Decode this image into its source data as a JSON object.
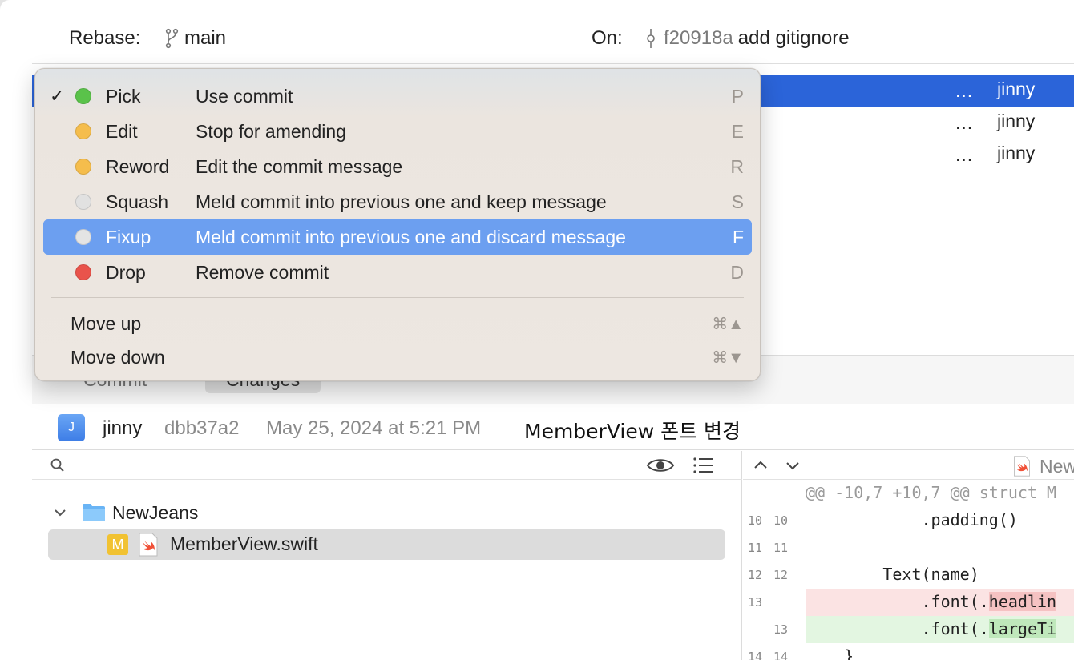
{
  "header": {
    "rebase_label": "Rebase:",
    "branch_icon": "branch-icon",
    "branch": "main",
    "on_label": "On:",
    "commit_icon": "commit-icon",
    "on_sha": "f20918a",
    "on_message": "add gitignore"
  },
  "commits": [
    {
      "dots": "...",
      "author": "jinny",
      "selected": true
    },
    {
      "dots": "...",
      "author": "jinny",
      "selected": false
    },
    {
      "dots": "...",
      "author": "jinny",
      "selected": false
    }
  ],
  "tabs": [
    {
      "label": "Commit",
      "active": false
    },
    {
      "label": "Changes",
      "active": true
    }
  ],
  "commit_info": {
    "avatar_letter": "J",
    "author": "jinny",
    "sha": "dbb37a2",
    "date": "May 25, 2024 at 5:21 PM",
    "message": "MemberView 폰트 변경"
  },
  "file_tree": {
    "folder": "NewJeans",
    "file_badge": "M",
    "file": "MemberView.swift"
  },
  "diff": {
    "file_label": "New",
    "lines": [
      {
        "type": "hunk",
        "old": "",
        "new": "",
        "code": "@@ -10,7 +10,7 @@ struct M"
      },
      {
        "type": "ctx",
        "old": "10",
        "new": "10",
        "code": "            .padding()"
      },
      {
        "type": "ctx",
        "old": "11",
        "new": "11",
        "code": ""
      },
      {
        "type": "ctx",
        "old": "12",
        "new": "12",
        "code": "        Text(name)"
      },
      {
        "type": "del",
        "old": "13",
        "new": "",
        "code": "            .font(.",
        "hl": "headlin"
      },
      {
        "type": "add",
        "old": "",
        "new": "13",
        "code": "            .font(.",
        "hl": "largeTi"
      },
      {
        "type": "ctx",
        "old": "14",
        "new": "14",
        "code": "    }"
      }
    ]
  },
  "menu": {
    "items": [
      {
        "label": "Pick",
        "desc": "Use commit",
        "key": "P",
        "dot_color": "#5ac24a",
        "checked": true,
        "highlight": false
      },
      {
        "label": "Edit",
        "desc": "Stop for amending",
        "key": "E",
        "dot_color": "#f5bd4c",
        "checked": false,
        "highlight": false
      },
      {
        "label": "Reword",
        "desc": "Edit the commit message",
        "key": "R",
        "dot_color": "#f5bd4c",
        "checked": false,
        "highlight": false
      },
      {
        "label": "Squash",
        "desc": "Meld commit into previous one and keep message",
        "key": "S",
        "dot_color": "#e1e1e1",
        "checked": false,
        "highlight": false
      },
      {
        "label": "Fixup",
        "desc": "Meld commit into previous one and discard message",
        "key": "F",
        "dot_color": "#e4e4e4",
        "checked": false,
        "highlight": true
      },
      {
        "label": "Drop",
        "desc": "Remove commit",
        "key": "D",
        "dot_color": "#e9534b",
        "checked": false,
        "highlight": false
      }
    ],
    "check_mark": "✓",
    "move_up": {
      "label": "Move up",
      "key": "⌘▲"
    },
    "move_down": {
      "label": "Move down",
      "key": "⌘▼"
    }
  }
}
